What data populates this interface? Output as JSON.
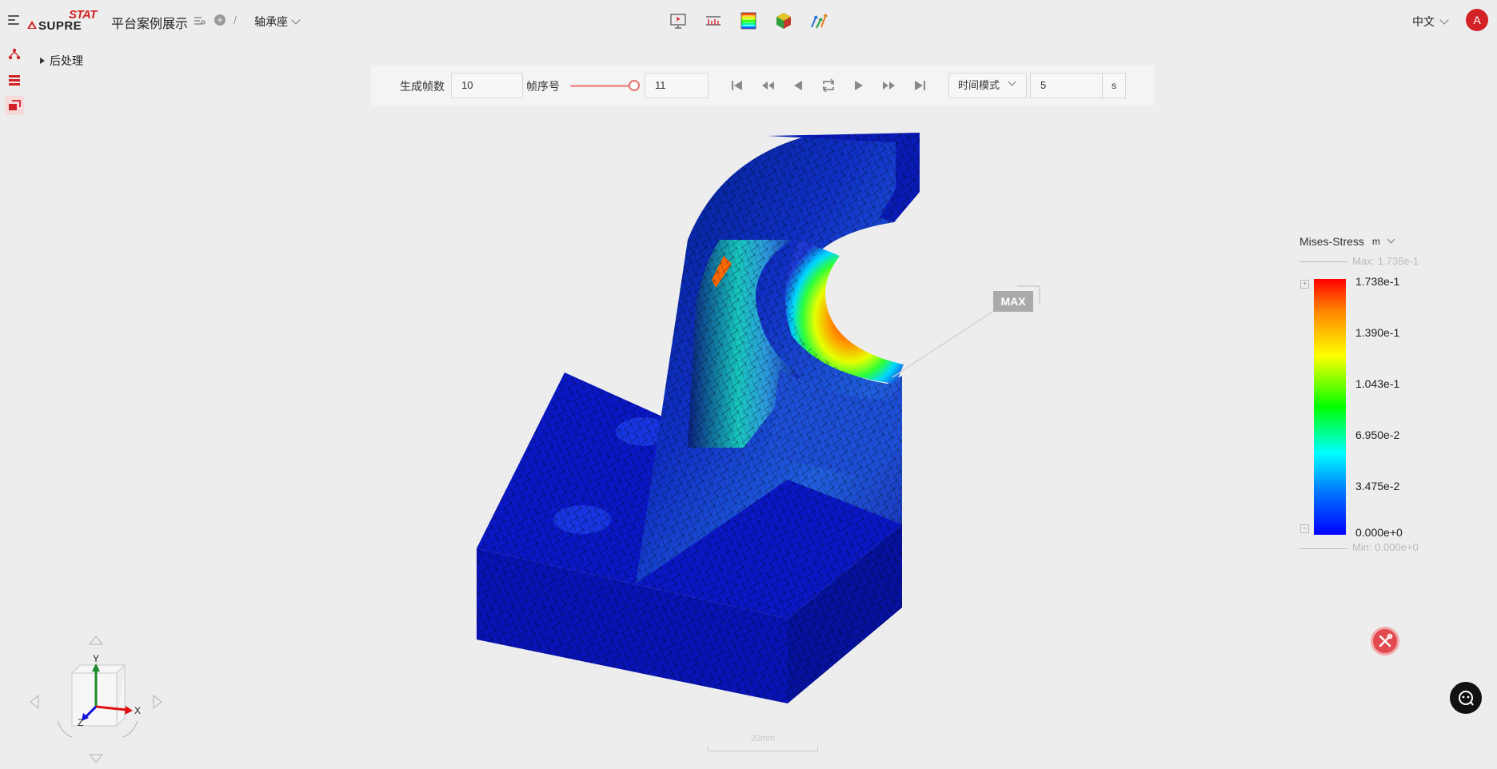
{
  "header": {
    "logo_top": "STAT",
    "logo_bottom": "SUPRE",
    "project_title": "平台案例展示",
    "crumb_separator": "/",
    "model_name": "轴承座",
    "language": "中文",
    "avatar_initial": "A"
  },
  "tree": {
    "node_label": "后处理"
  },
  "animation": {
    "frames_label": "生成帧数",
    "frames_value": "10",
    "frame_index_label": "帧序号",
    "frame_index_value": "11",
    "mode_value": "时间模式",
    "time_value": "5",
    "time_unit": "s"
  },
  "viewport": {
    "max_marker": "MAX",
    "scale_label": "20mm",
    "axis_x": "X",
    "axis_y": "Y",
    "axis_z": "Z"
  },
  "legend": {
    "title": "Mises-Stress",
    "unit": "m",
    "max_text": "Max: 1.738e-1",
    "min_text": "Min: 0.000e+0",
    "ticks": [
      "1.738e-1",
      "1.390e-1",
      "1.043e-1",
      "6.950e-2",
      "3.475e-2",
      "0.000e+0"
    ],
    "gradient_colors": [
      "#ff0000",
      "#ff8000",
      "#ffff00",
      "#00ff00",
      "#00ffff",
      "#0080ff",
      "#0000ff"
    ]
  },
  "colors": {
    "brand_red": "#d32226",
    "accent_pink": "#ef9a9a"
  },
  "icons": {
    "top_tools": [
      "probe-icon",
      "ruler-icon",
      "color-legend-icon",
      "cube-display-icon",
      "vector-arrows-icon"
    ],
    "left_rail": [
      "model-tree-icon",
      "layers-icon",
      "postprocess-icon"
    ]
  }
}
